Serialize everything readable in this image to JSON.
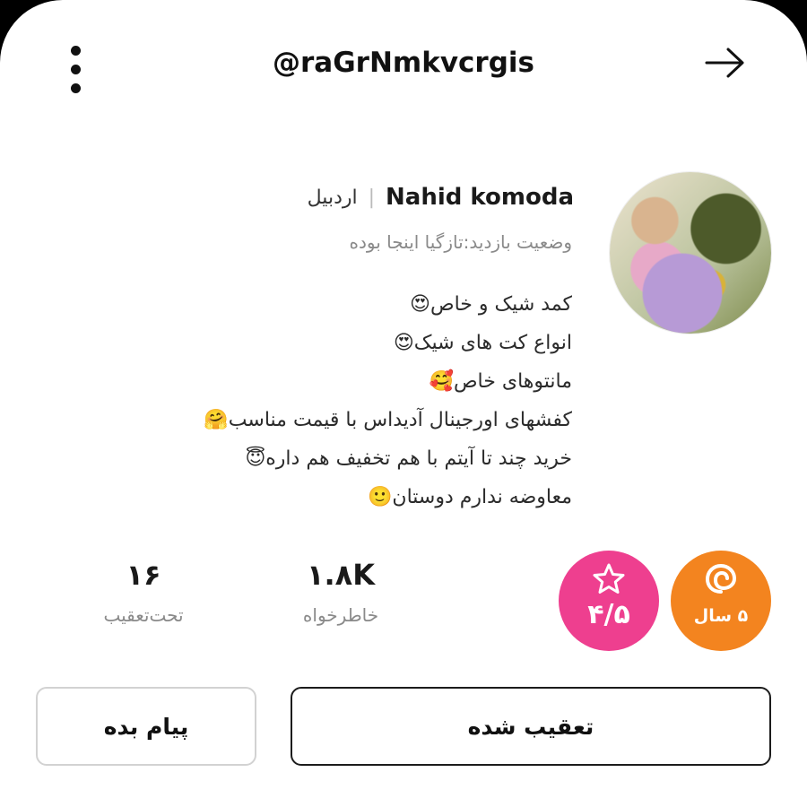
{
  "header": {
    "username": "@raGrNmkvcrgis",
    "menu_icon": "more-vertical-icon",
    "back_icon": "arrow-right-icon"
  },
  "profile": {
    "avatar_icon": "profile-avatar",
    "name": "Nahid komoda",
    "city": "اردبیل",
    "visit_status": "وضعیت بازدید:تازگیا اینجا بوده",
    "bio": [
      "کمد شیک و خاص😍",
      "انواع کت های شیک😍",
      "مانتوهای خاص🥰",
      "کفشهای اورجینال آدیداس با قیمت مناسب🤗",
      "خرید چند تا آیتم با هم تخفیف هم داره😇",
      "معاوضه ندارم دوستان🙂"
    ]
  },
  "stats": {
    "membership": {
      "label": "۵ سال",
      "icon": "spiral-icon",
      "color": "#f3841f"
    },
    "rating": {
      "label": "۴/۵",
      "icon": "star-icon",
      "color": "#ee3f8f"
    },
    "followers": {
      "value": "۱.۸K",
      "label": "خاطرخواه"
    },
    "following": {
      "value": "۱۶",
      "label": "تحت‌تعقیب"
    }
  },
  "actions": {
    "follow_label": "تعقیب شده",
    "message_label": "پیام بده"
  }
}
